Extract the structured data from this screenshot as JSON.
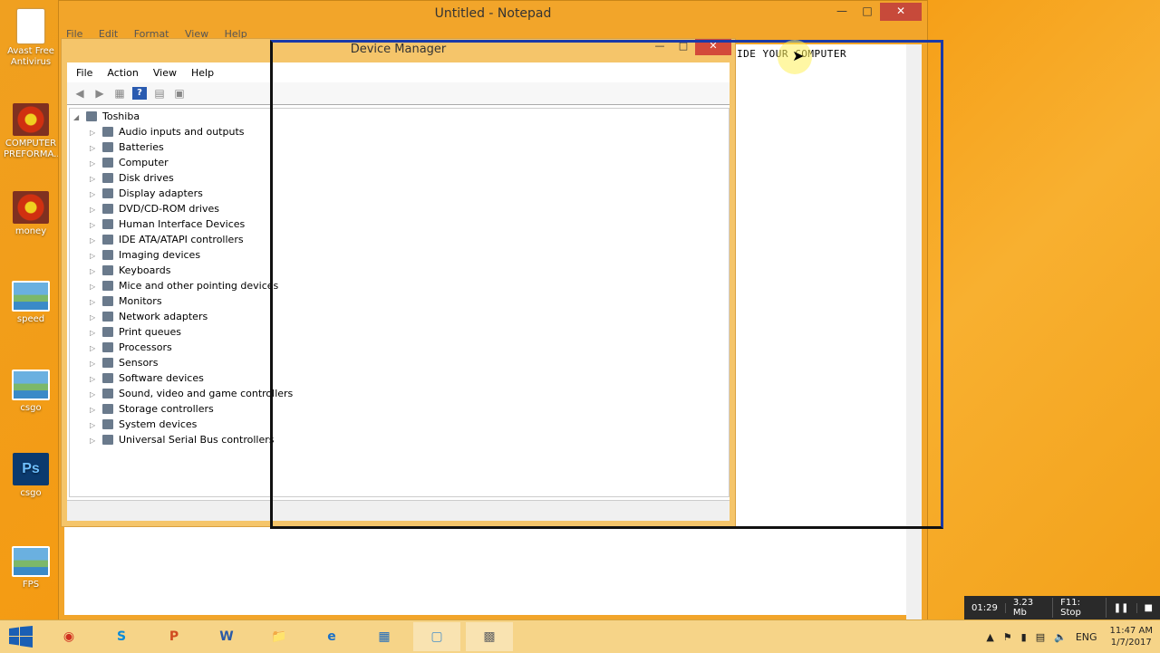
{
  "desktop": {
    "icons": [
      {
        "label": "Avast Free Antivirus",
        "icon": "document-icon"
      },
      {
        "label": "COMPUTER PREFORMA...",
        "icon": "flower-icon"
      },
      {
        "label": "money",
        "icon": "flower-icon"
      },
      {
        "label": "speed",
        "icon": "picture-icon"
      },
      {
        "label": "csgo",
        "icon": "picture-icon"
      },
      {
        "label": "csgo",
        "icon": "photoshop-icon"
      },
      {
        "label": "FPS",
        "icon": "picture-icon"
      }
    ]
  },
  "notepad": {
    "title": "Untitled - Notepad",
    "menu": [
      "File",
      "Edit",
      "Format",
      "View",
      "Help"
    ],
    "text": "IDE YOUR COMPUTER"
  },
  "device_manager": {
    "title": "Device Manager",
    "menu": [
      "File",
      "Action",
      "View",
      "Help"
    ],
    "root": "Toshiba",
    "items": [
      "Audio inputs and outputs",
      "Batteries",
      "Computer",
      "Disk drives",
      "Display adapters",
      "DVD/CD-ROM drives",
      "Human Interface Devices",
      "IDE ATA/ATAPI controllers",
      "Imaging devices",
      "Keyboards",
      "Mice and other pointing devices",
      "Monitors",
      "Network adapters",
      "Print queues",
      "Processors",
      "Sensors",
      "Software devices",
      "Sound, video and game controllers",
      "Storage controllers",
      "System devices",
      "Universal Serial Bus controllers"
    ]
  },
  "recorder": {
    "time": "01:29",
    "size": "3.23 Mb",
    "stop": "F11: Stop"
  },
  "taskbar": {
    "apps": [
      "Chrome",
      "Skype",
      "PowerPoint",
      "Word",
      "File Explorer",
      "Internet Explorer",
      "Snipping",
      "Notepad",
      "Device Manager"
    ],
    "language": "ENG",
    "time": "11:47 AM",
    "date": "1/7/2017"
  }
}
